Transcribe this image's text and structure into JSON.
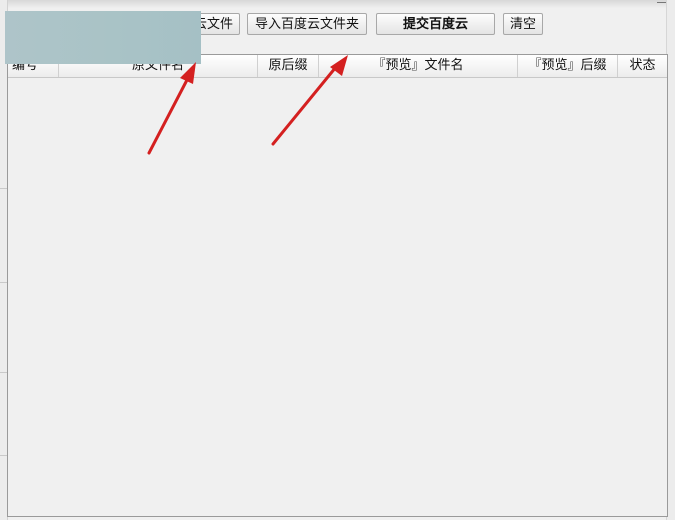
{
  "toolbar": {
    "import_file_label": "云文件",
    "import_folder_label": "导入百度云文件夹",
    "submit_label": "提交百度云",
    "clear_label": "清空"
  },
  "table": {
    "columns": [
      "编号",
      "原文件名",
      "原后缀",
      "『预览』文件名",
      "『预览』后缀",
      "状态"
    ],
    "rows": []
  },
  "colors": {
    "annotation_arrow": "#d42020",
    "redaction": "#aac3c7"
  }
}
